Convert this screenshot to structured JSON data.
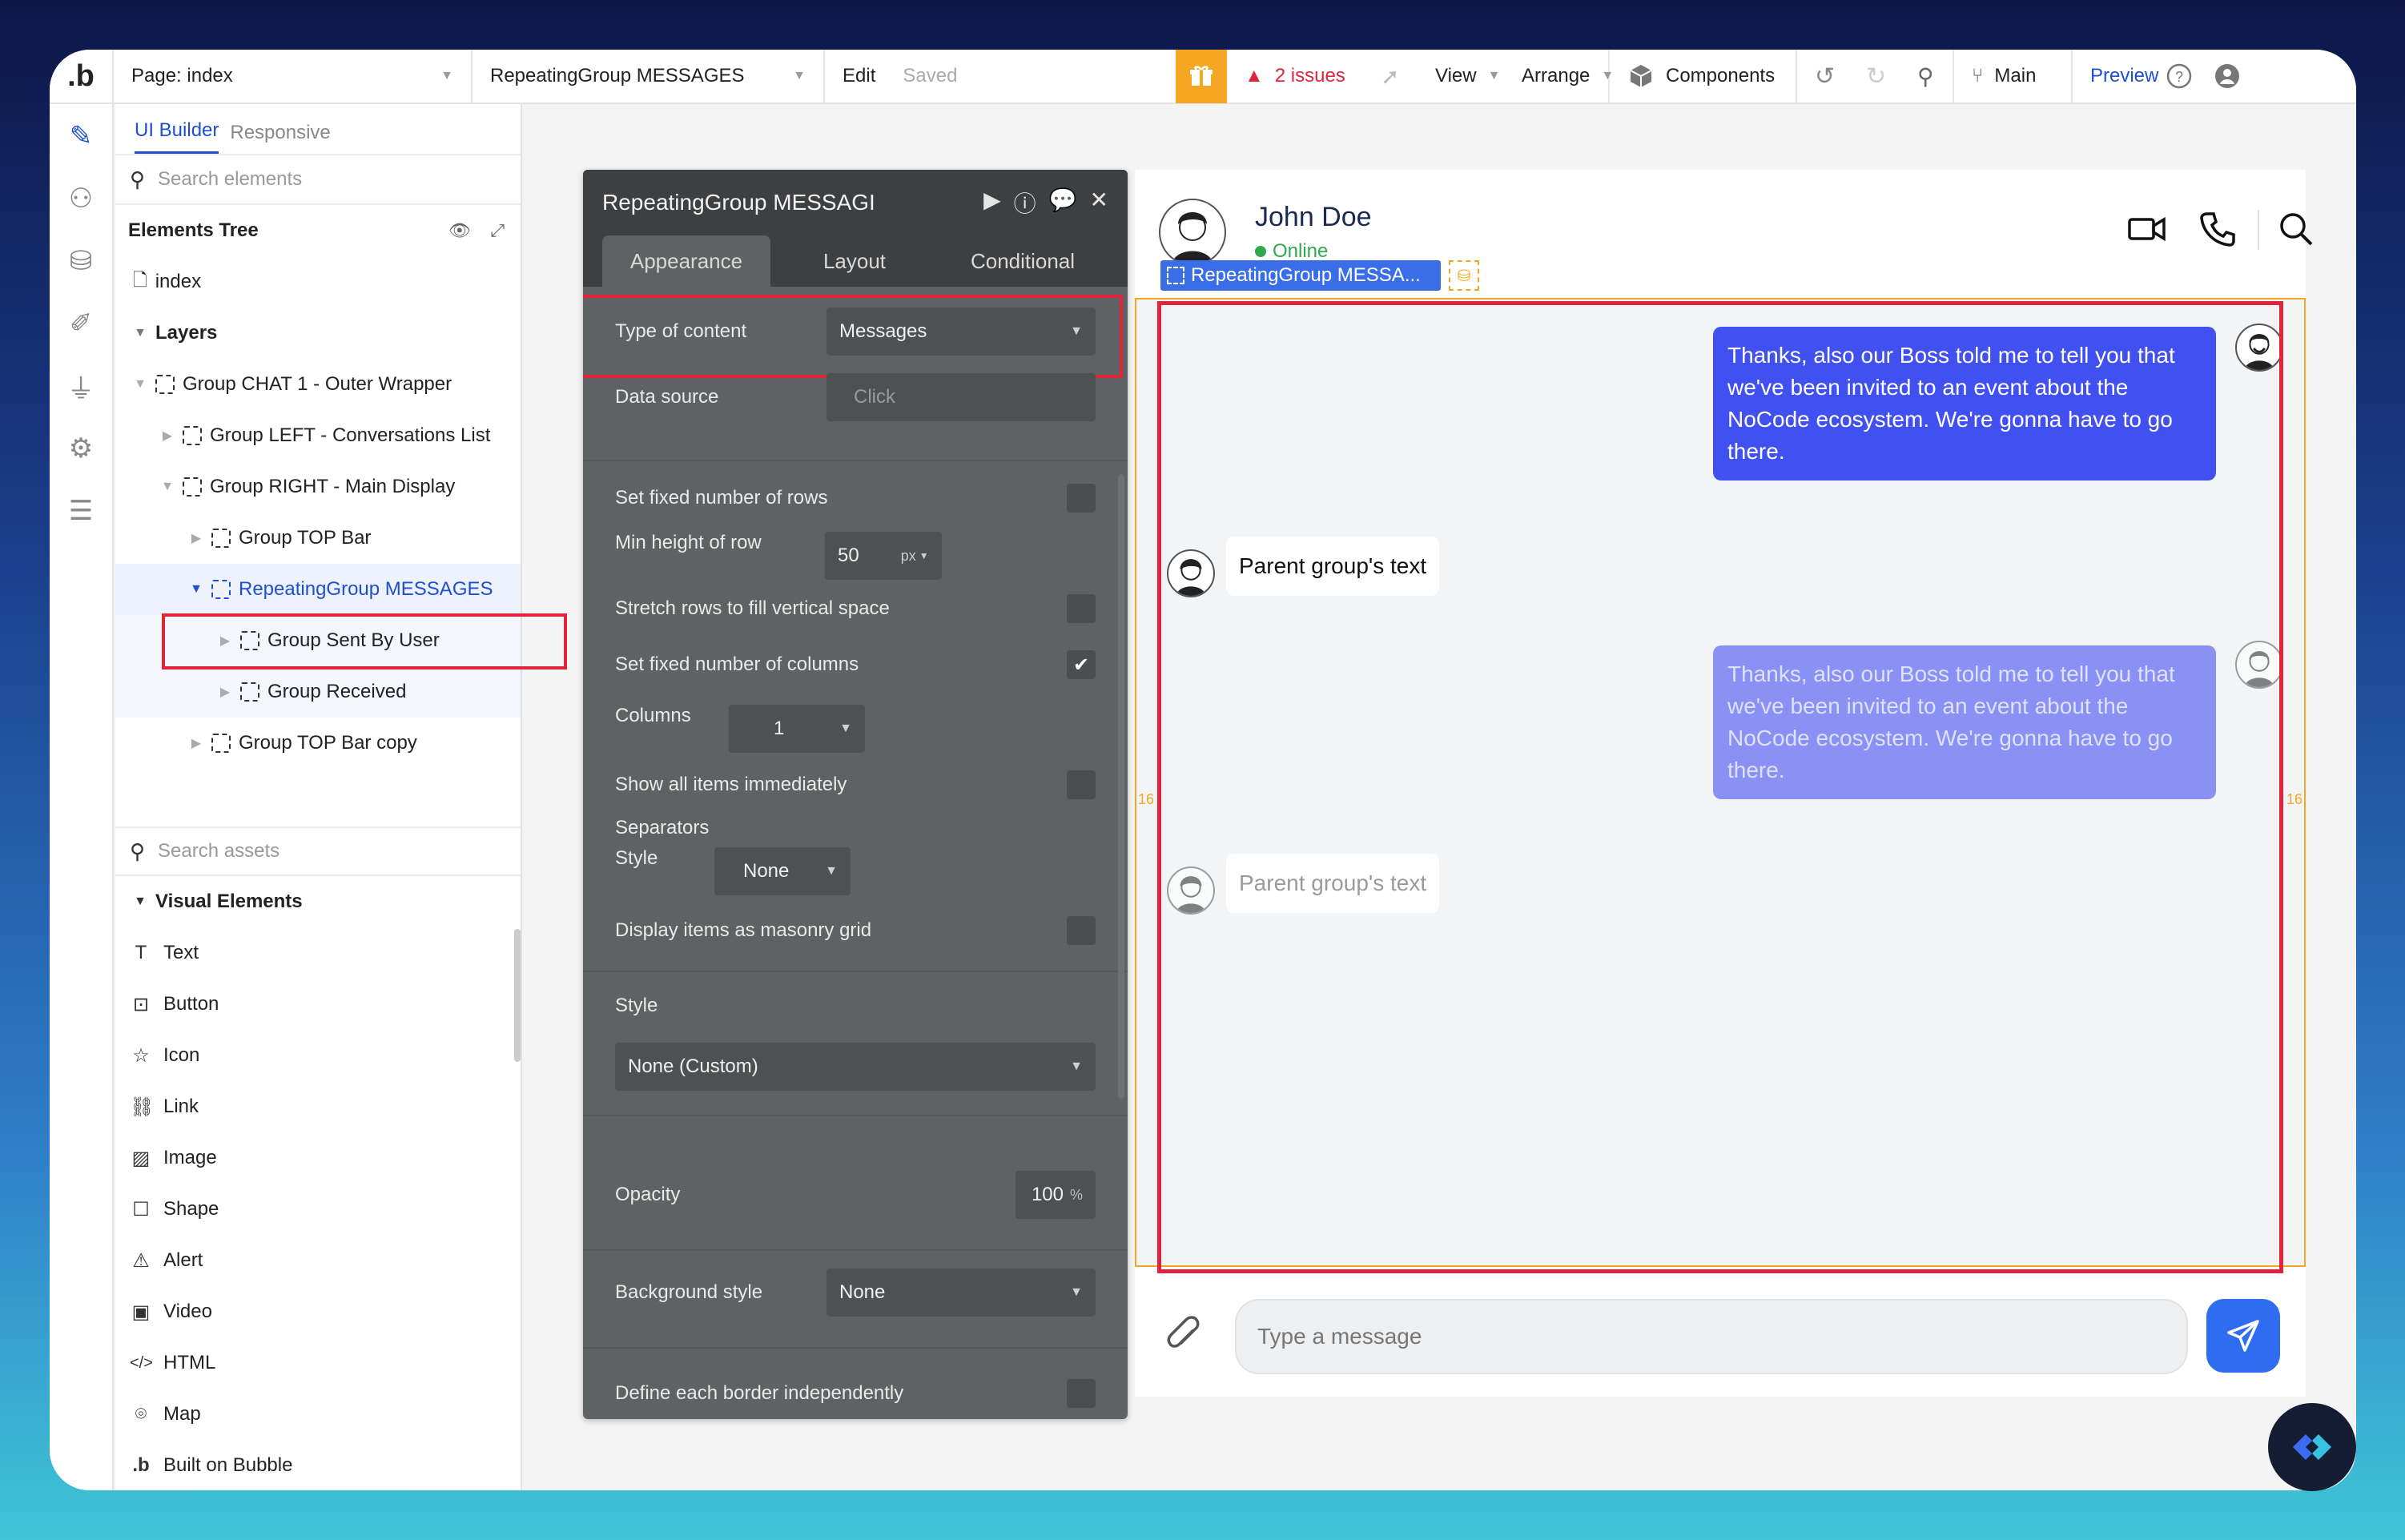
{
  "topbar": {
    "logo": ".b",
    "page_label": "Page: index",
    "element_select": "RepeatingGroup MESSAGES",
    "edit": "Edit",
    "saved": "Saved",
    "issues": "2 issues",
    "view": "View",
    "arrange": "Arrange",
    "components": "Components",
    "branch": "Main",
    "preview": "Preview"
  },
  "left_panel": {
    "tabs": [
      "UI Builder",
      "Responsive"
    ],
    "search_placeholder": "Search elements",
    "tree_title": "Elements Tree",
    "tree": [
      {
        "label": "index"
      },
      {
        "label": "Layers"
      },
      {
        "label": "Group CHAT 1 - Outer Wrapper"
      },
      {
        "label": "Group LEFT - Conversations List"
      },
      {
        "label": "Group RIGHT - Main Display"
      },
      {
        "label": "Group TOP Bar"
      },
      {
        "label": "RepeatingGroup MESSAGES"
      },
      {
        "label": "Group Sent By User"
      },
      {
        "label": "Group Received"
      },
      {
        "label": "Group TOP Bar copy"
      }
    ],
    "assets_placeholder": "Search assets",
    "visual_elements_title": "Visual Elements",
    "visual_elements": [
      "Text",
      "Button",
      "Icon",
      "Link",
      "Image",
      "Shape",
      "Alert",
      "Video",
      "HTML",
      "Map",
      "Built on Bubble"
    ]
  },
  "editor": {
    "title": "RepeatingGroup MESSAGI",
    "tabs": [
      "Appearance",
      "Layout",
      "Conditional"
    ],
    "type_of_content_label": "Type of content",
    "type_of_content_value": "Messages",
    "data_source_label": "Data source",
    "data_source_placeholder": "Click",
    "fixed_rows_label": "Set fixed number of rows",
    "min_height_label": "Min height of row",
    "min_height_value": "50",
    "min_height_unit": "px",
    "stretch_label": "Stretch rows to fill vertical space",
    "fixed_columns_label": "Set fixed number of columns",
    "fixed_columns_checked": true,
    "columns_label": "Columns",
    "columns_value": "1",
    "show_all_label": "Show all items immediately",
    "separators_label": "Separators",
    "sep_style_label": "Style",
    "sep_style_value": "None",
    "masonry_label": "Display items as masonry grid",
    "style_label": "Style",
    "style_value": "None (Custom)",
    "opacity_label": "Opacity",
    "opacity_value": "100",
    "opacity_unit": "%",
    "bg_style_label": "Background style",
    "bg_style_value": "None",
    "border_label": "Define each border independently"
  },
  "chat": {
    "contact_name": "John Doe",
    "status": "Online",
    "rg_label": "RepeatingGroup MESSA...",
    "messages": [
      {
        "text": "Thanks, also our Boss told me to tell you that we've been invited to an event about the NoCode ecosystem. We're gonna have to go there."
      },
      {
        "text": "Parent group's text"
      },
      {
        "text": "Thanks, also our Boss told me to tell you that we've been invited to an event about the NoCode ecosystem. We're gonna have to go there."
      },
      {
        "text": "Parent group's text"
      }
    ],
    "padding_marker": "16",
    "input_placeholder": "Type a message"
  },
  "colors": {
    "accent": "#1f4fd1",
    "highlight": "#e0243b",
    "sent_bubble": "#4150f0",
    "warning": "#f5a623"
  }
}
